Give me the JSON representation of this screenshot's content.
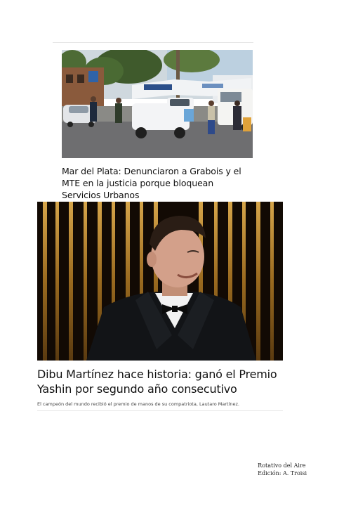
{
  "articles": [
    {
      "headline": "Mar del Plata: Denunciaron a Grabois y el MTE en la justicia porque bloquean Servicios Urbanos",
      "photo_alt": "Mar del Plata: protesta con banderas del MTE y camionetas frente a Servicios Urbanos"
    },
    {
      "headline": "Dibu Martínez hace historia: ganó el Premio Yashin por segundo año consecutivo",
      "summary": "El campeón del mundo recibió el premio de manos de su compatriota, Lautaro Martínez.",
      "photo_alt": "Dibu Martínez sonriendo con smoking y moño negro frente a un fondo dorado"
    }
  ],
  "credits": {
    "line1": "Rotativo del Aire",
    "line2": "Edición: A. Troisi"
  }
}
